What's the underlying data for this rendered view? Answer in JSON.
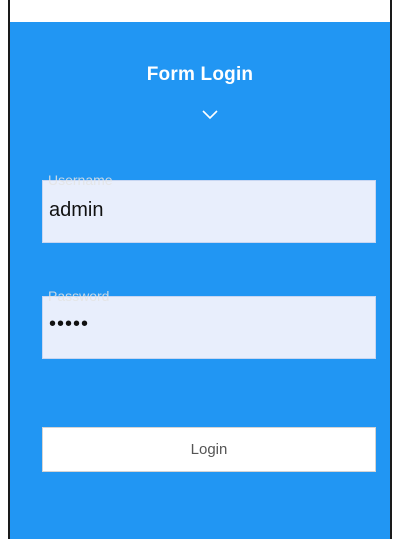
{
  "form": {
    "title": "Form Login",
    "chevron_icon": "chevron-down-icon",
    "username": {
      "label": "Username",
      "value": "admin"
    },
    "password": {
      "label": "Password",
      "masked_value": "•••••"
    },
    "login_label": "Login"
  },
  "colors": {
    "panel": "#2196f3",
    "field_bg": "#e8eefc",
    "button_bg": "#ffffff"
  }
}
